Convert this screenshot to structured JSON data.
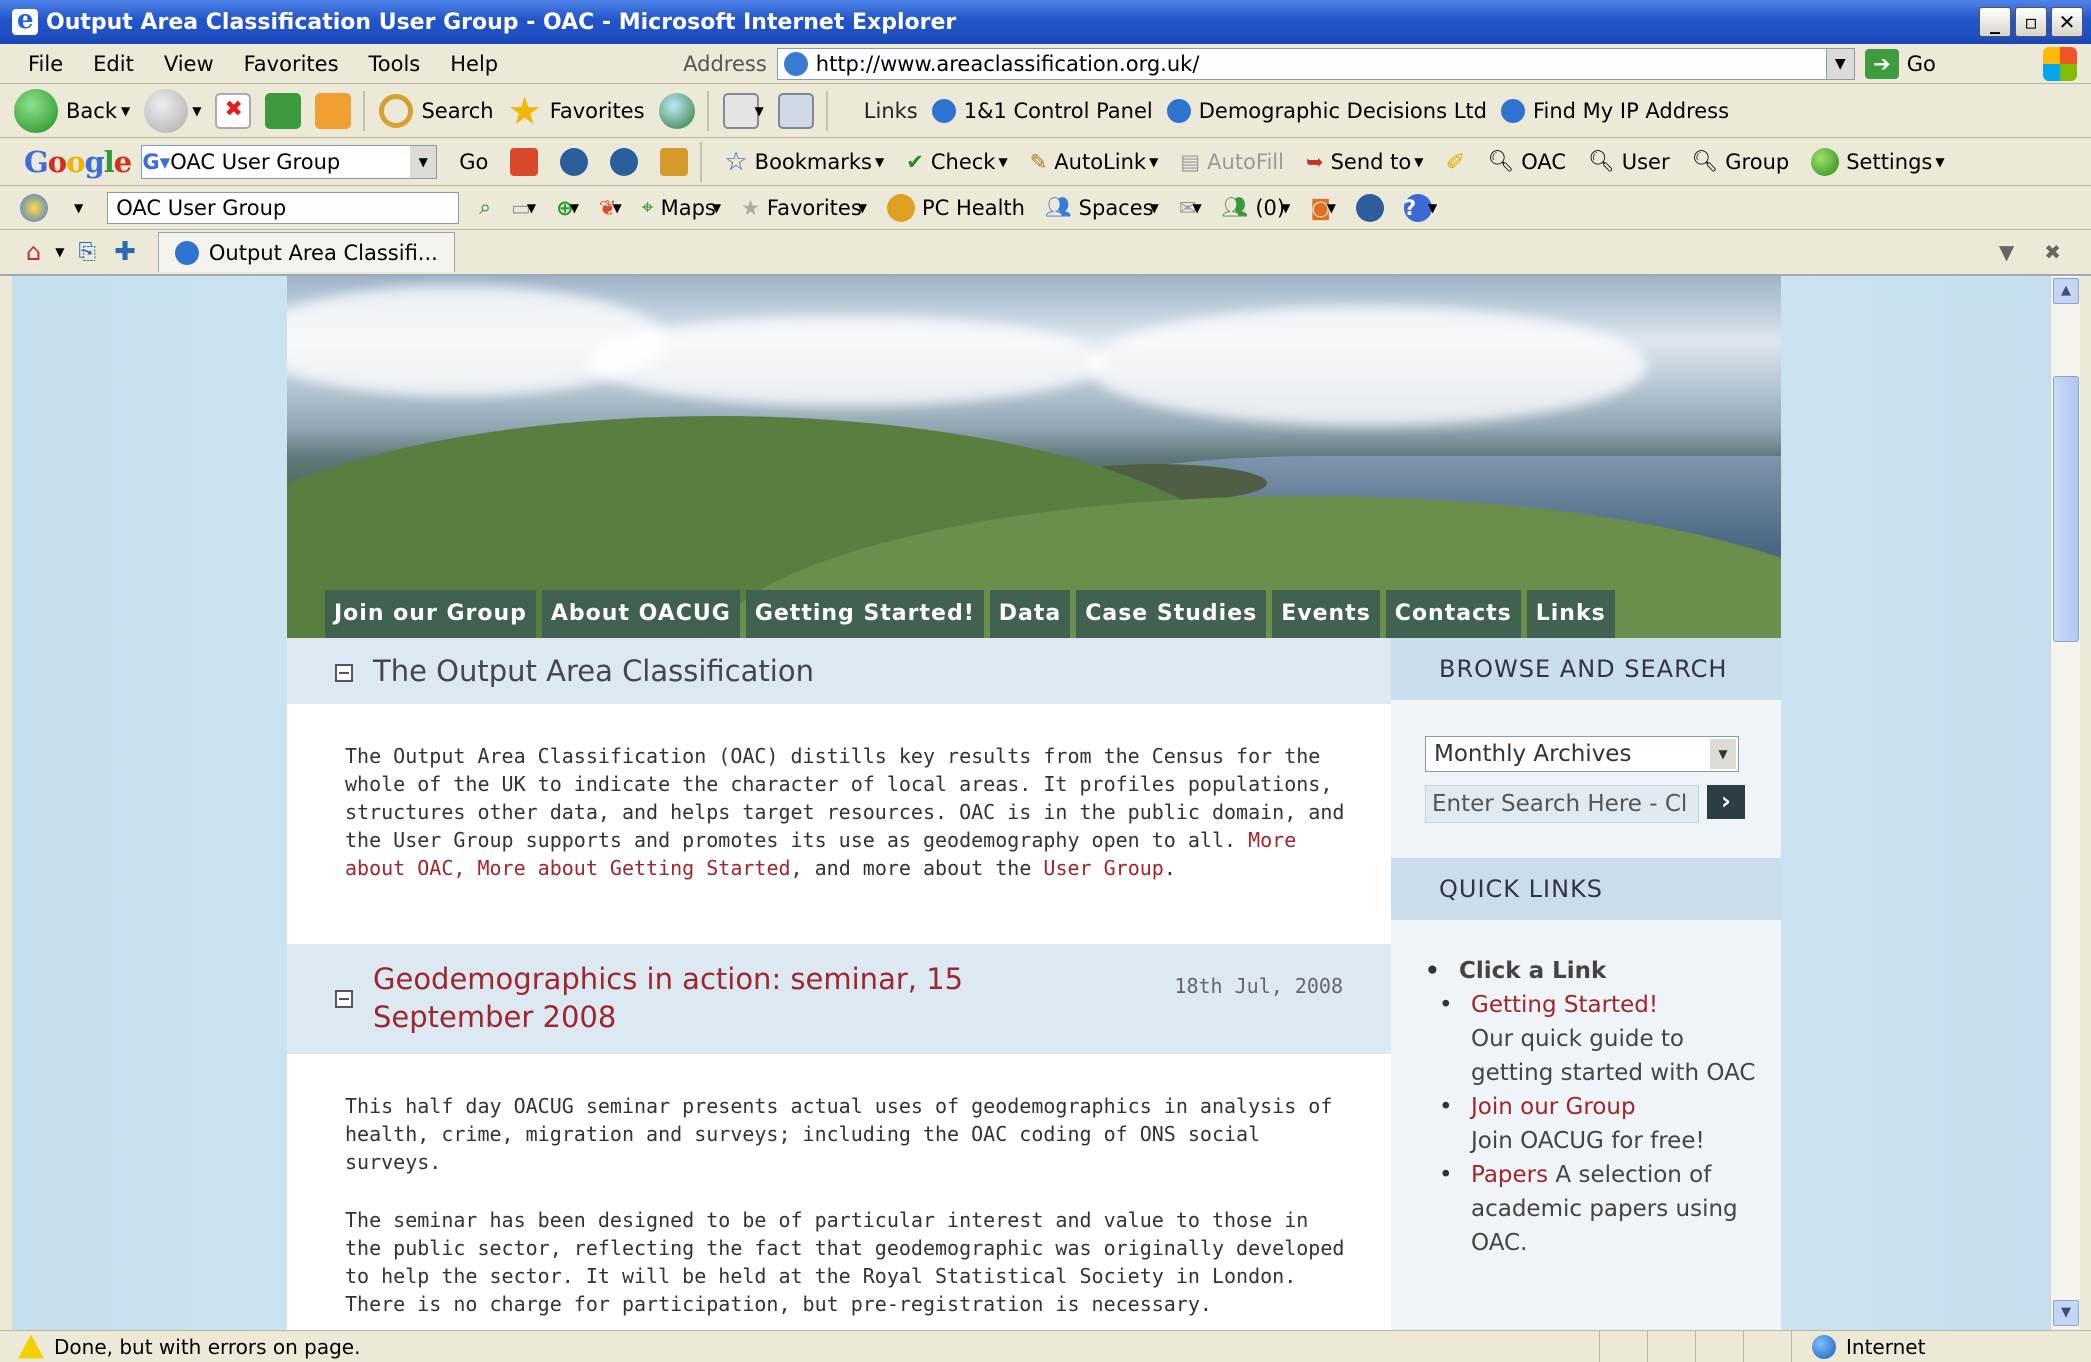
{
  "window": {
    "title": "Output Area Classification User Group - OAC - Microsoft Internet Explorer",
    "controls": [
      "_",
      "▫",
      "✕"
    ]
  },
  "menu": {
    "items": [
      "File",
      "Edit",
      "View",
      "Favorites",
      "Tools",
      "Help"
    ],
    "address_label": "Address",
    "url": "http://www.areaclassification.org.uk/",
    "go_label": "Go"
  },
  "toolbar": {
    "back": "Back",
    "search": "Search",
    "favorites": "Favorites",
    "links_label": "Links",
    "links": [
      "1&1 Control Panel",
      "Demographic Decisions Ltd",
      "Find My IP Address"
    ]
  },
  "google_toolbar": {
    "logo": "Google",
    "search_value": "OAC User Group",
    "go": "Go",
    "bookmarks": "Bookmarks",
    "check": "Check",
    "autolink": "AutoLink",
    "autofill": "AutoFill",
    "send_to": "Send to",
    "buttons": [
      "OAC",
      "User",
      "Group"
    ],
    "settings": "Settings"
  },
  "msn_toolbar": {
    "search_value": "OAC User Group",
    "maps": "Maps",
    "favorites": "Favorites",
    "pc_health": "PC Health",
    "spaces": "Spaces",
    "messenger_count": "(0)"
  },
  "tabs": {
    "active_tab": "Output Area Classifi..."
  },
  "site": {
    "nav": [
      "Join our Group",
      "About OACUG",
      "Getting Started!",
      "Data",
      "Case Studies",
      "Events",
      "Contacts",
      "Links"
    ],
    "intro": {
      "title": "The Output Area Classification",
      "text_1": "The Output Area Classification (OAC) distills key results from the Census for the whole of the UK to indicate the character of local areas. It profiles populations, structures other data, and helps target resources. OAC is in the public domain, and the User Group supports and promotes its use as geodemography open to all. ",
      "link_1": "More about OAC,",
      "link_2": "More about Getting Started",
      "text_2": ", and more about the ",
      "link_3": "User Group",
      "text_3": "."
    },
    "post": {
      "title": "Geodemographics in action: seminar, 15 September 2008",
      "date": "18th Jul, 2008",
      "para_1": "This half day OACUG seminar presents actual uses of geodemographics in analysis of health, crime, migration and surveys; including the OAC coding of ONS social surveys.",
      "para_2": "The seminar has been designed to be of particular interest and value to those in the public sector, reflecting the fact that geodemographic was originally developed to help the sector. It will be held at the Royal Statistical Society in London. There is no charge for participation, but pre-registration is necessary."
    },
    "sidebar": {
      "browse_title": "BROWSE AND SEARCH",
      "archives_selected": "Monthly Archives",
      "search_placeholder": "Enter Search Here - Cl",
      "quick_links_title": "QUICK LINKS",
      "quick_links_top": "Click a Link",
      "quick_links": [
        {
          "label": "Getting Started!",
          "desc": "Our quick guide to getting started with OAC"
        },
        {
          "label": "Join our Group",
          "desc": "Join OACUG for free!"
        },
        {
          "label": "Papers",
          "desc": " A selection of academic papers using OAC."
        }
      ]
    }
  },
  "status": {
    "text": "Done, but with errors on page.",
    "zone": "Internet"
  }
}
